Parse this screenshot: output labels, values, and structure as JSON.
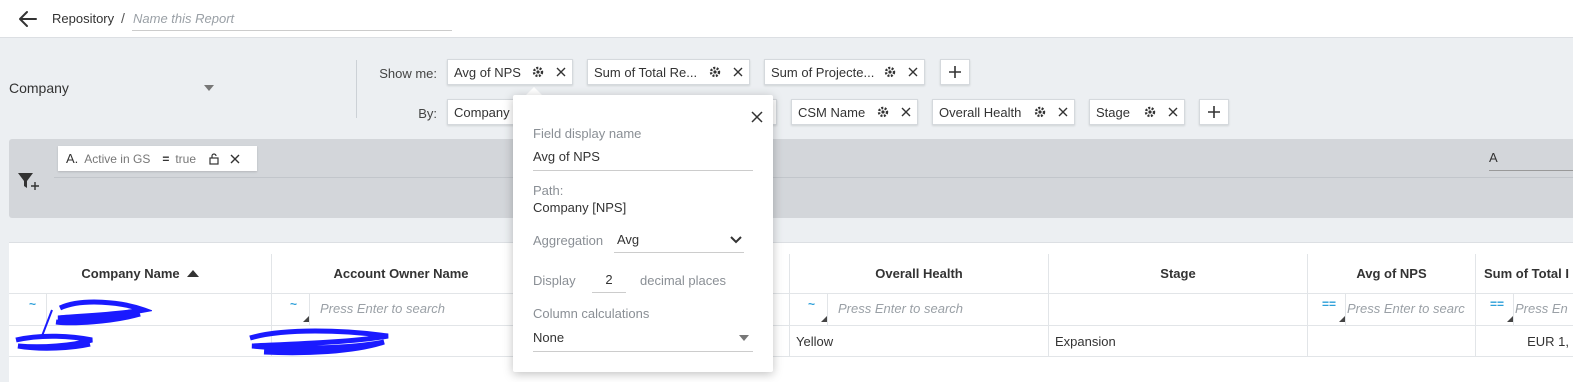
{
  "header": {
    "breadcrumb": "Repository",
    "separator": "/",
    "report_name_placeholder": "Name this Report",
    "report_name_value": ""
  },
  "config": {
    "source_object": "Company",
    "show_me_label": "Show me:",
    "by_label": "By:",
    "show_me_chips": [
      "Avg of NPS",
      "Sum of Total Re...",
      "Sum of Projecte..."
    ],
    "by_chips": [
      "Company N",
      "CSM Name",
      "Overall Health",
      "Stage"
    ]
  },
  "filters": {
    "chips": [
      {
        "letter": "A.",
        "field": "Active in GS",
        "operator": "=",
        "value": "true"
      }
    ],
    "advanced_logic": "A"
  },
  "table": {
    "columns": [
      "Company Name",
      "Account Owner Name",
      "Overall Health",
      "Stage",
      "Avg of NPS",
      "Sum of Total I"
    ],
    "sorted_column": "Company Name",
    "filter_ops": [
      "~",
      "~",
      "~",
      "==",
      "=="
    ],
    "search_placeholder": "Press Enter to search",
    "search_placeholder_short": "Press Enter to searc",
    "search_placeholder_clip": "Press En",
    "rows": [
      {
        "overall_health": "Yellow",
        "stage": "Expansion",
        "sum_total": "EUR 1,"
      }
    ]
  },
  "popover": {
    "display_name_label": "Field display name",
    "display_name_value": "Avg of NPS",
    "path_label": "Path:",
    "path_value": "Company [NPS]",
    "aggregation_label": "Aggregation",
    "aggregation_value": "Avg",
    "display_label": "Display",
    "decimal_value": "2",
    "decimal_suffix": "decimal places",
    "column_calc_label": "Column calculations",
    "column_calc_value": "None"
  },
  "colors": {
    "accent": "#2c9fd9",
    "filter_band": "#d3d6da",
    "page_bg": "#eceff2",
    "redaction": "#1a1aff"
  }
}
